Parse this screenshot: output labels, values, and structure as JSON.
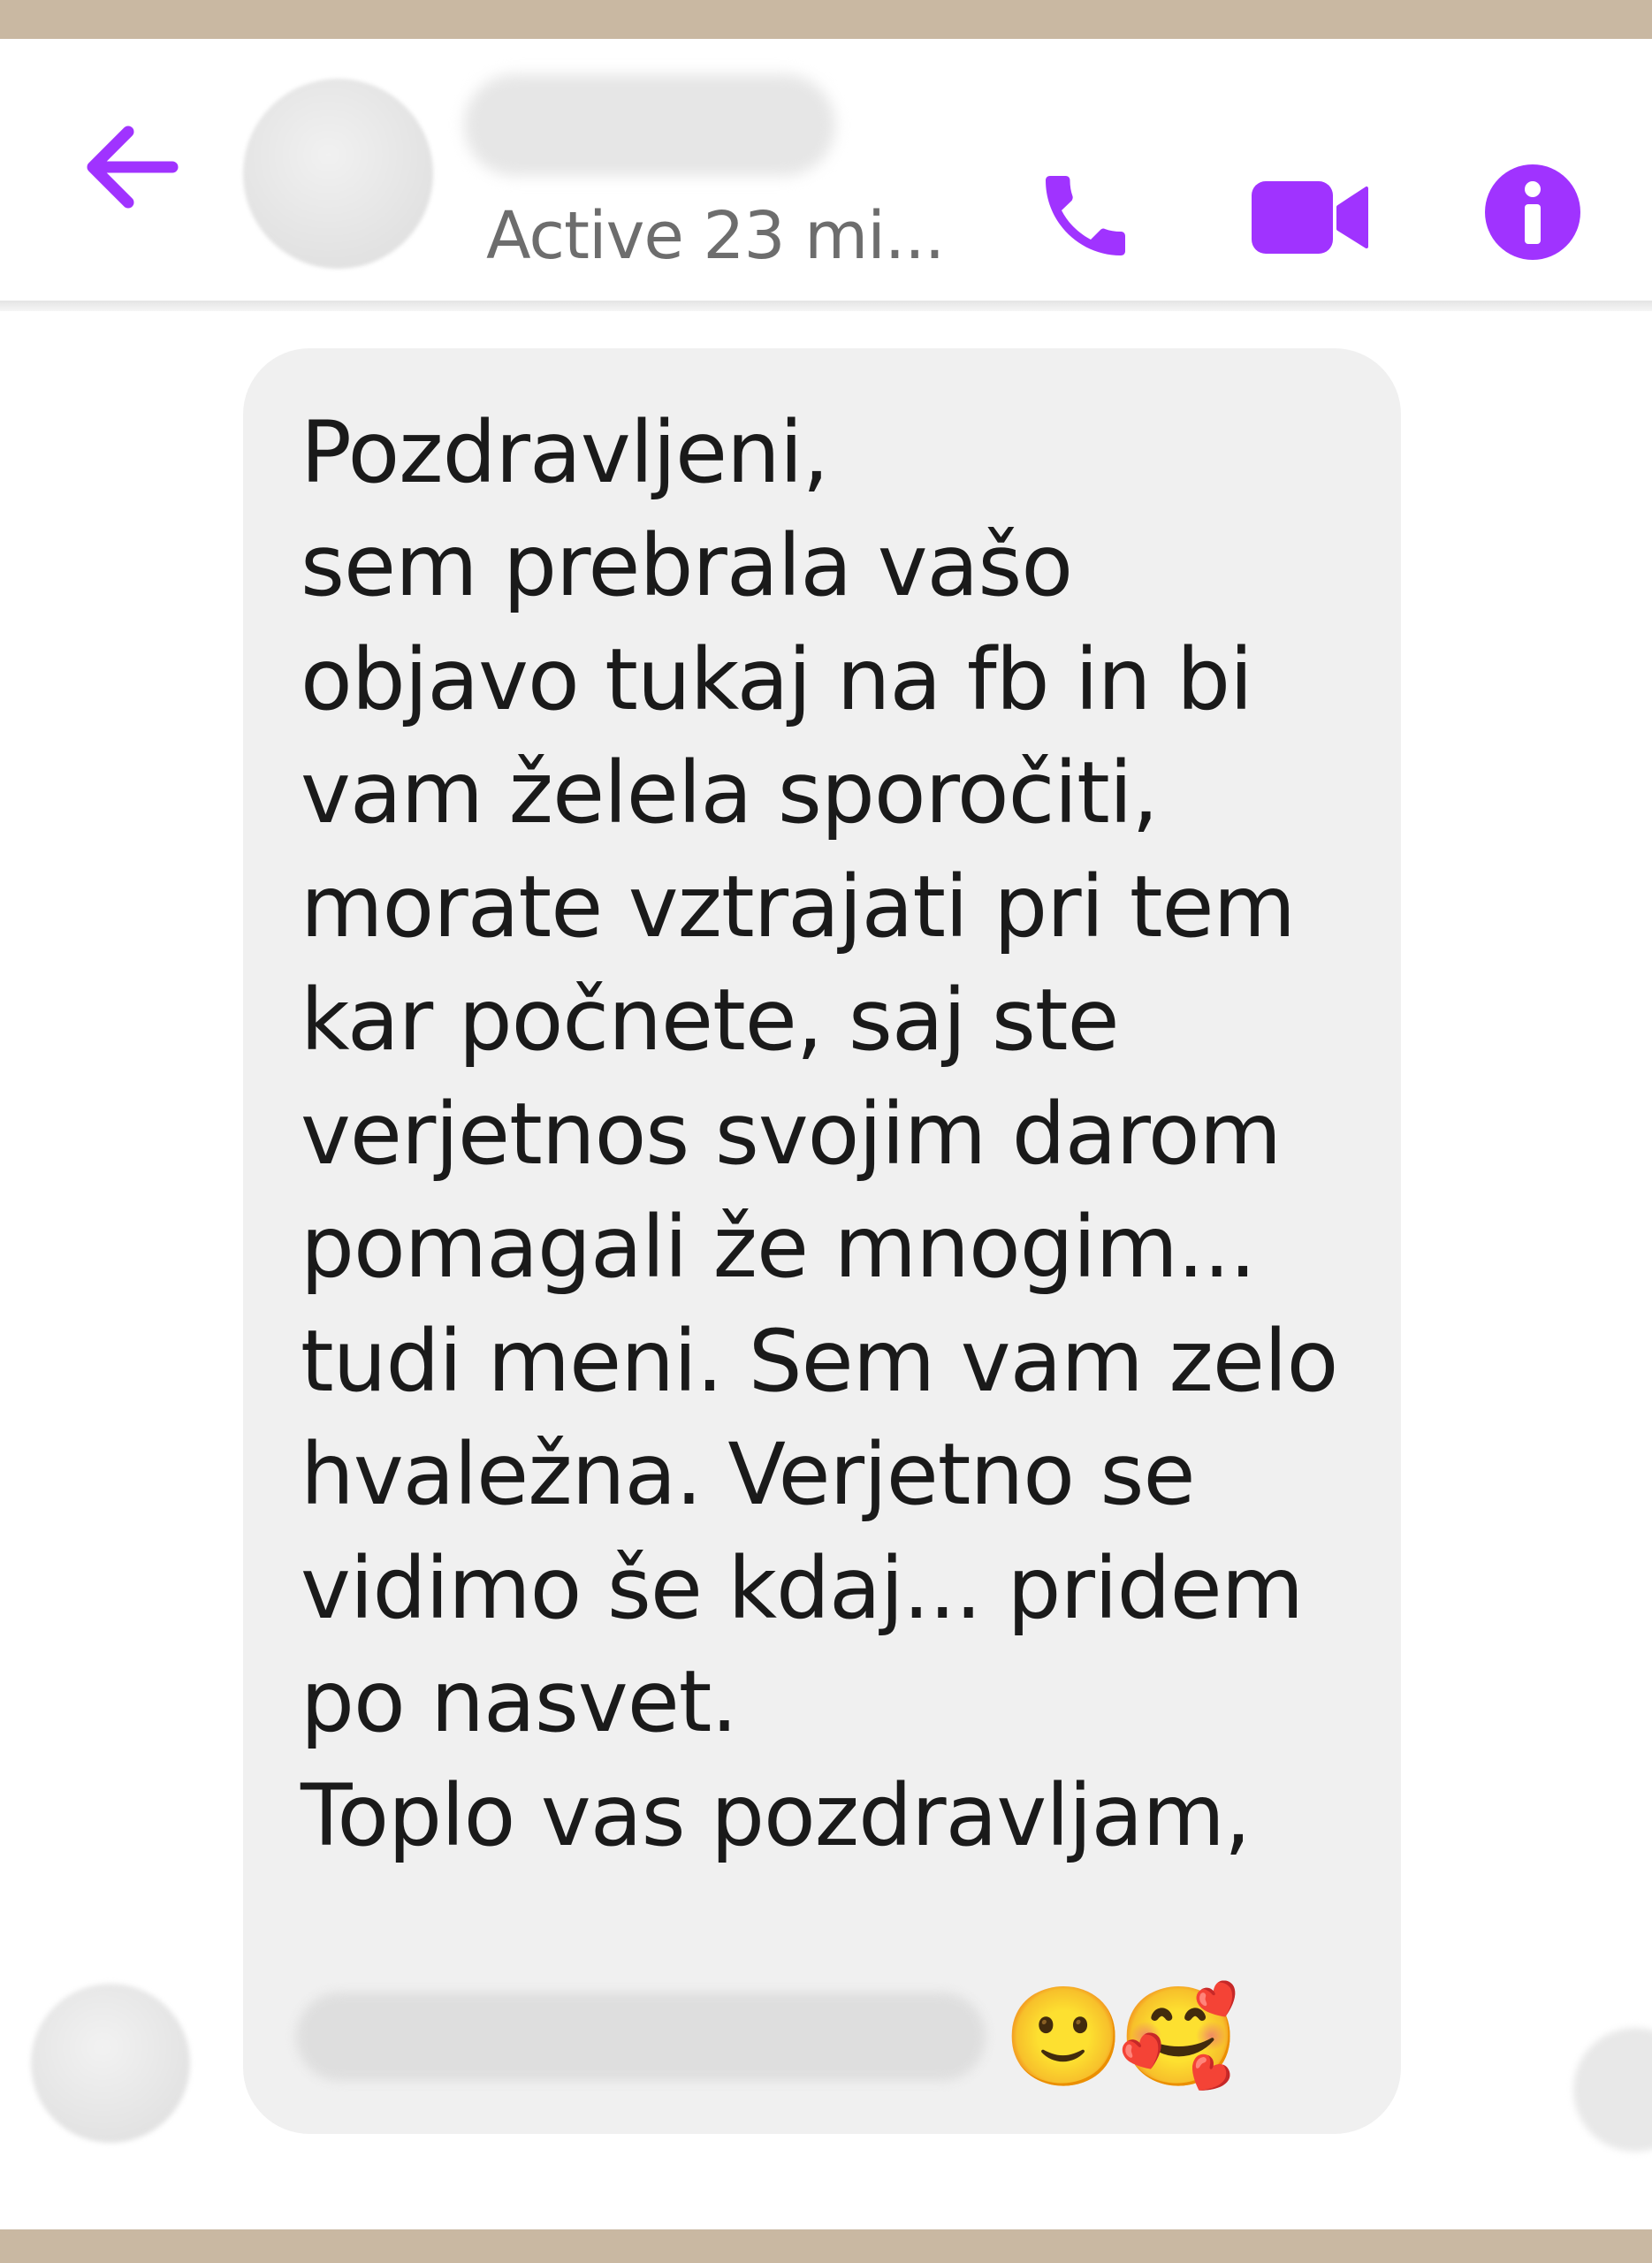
{
  "conversation": {
    "status": "Active 23 mi..."
  },
  "header_icons": {
    "back": "arrow-left-icon",
    "call": "phone-icon",
    "video": "video-camera-icon",
    "info": "info-icon"
  },
  "colors": {
    "accent": "#a033ff",
    "bubble": "#f0f0f0",
    "frame": "#c9b8a2"
  },
  "message": {
    "lines": [
      "Pozdravljeni,",
      "sem prebrala vašo",
      "objavo tukaj na fb in bi",
      "vam želela sporočiti,",
      "morate vztrajati pri tem",
      "kar počnete, saj ste",
      "verjetnos svojim darom",
      "pomagali že mnogim...",
      "tudi meni. Sem vam zelo",
      "hvaležna. Verjetno se",
      "vidimo še kdaj... pridem",
      "po nasvet.",
      "Toplo vas pozdravljam,"
    ],
    "emoji_1": "🙂",
    "emoji_2": "🥰"
  }
}
